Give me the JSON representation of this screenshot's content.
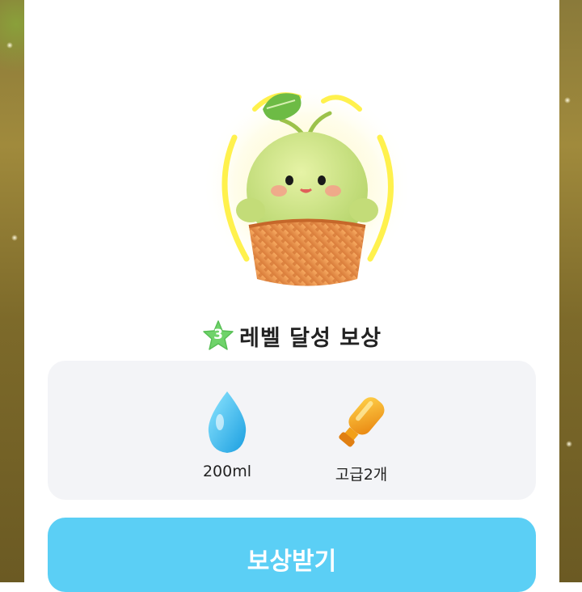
{
  "popup": {
    "title": "레벨 달성 보상",
    "level": "3",
    "claim_label": "보상받기"
  },
  "rewards": [
    {
      "icon": "water-drop-icon",
      "label": "200ml"
    },
    {
      "icon": "fertilizer-bottle-icon",
      "label": "고급2개"
    }
  ],
  "colors": {
    "accent": "#5bcff5",
    "badge": "#6fd36a",
    "reward_bg": "#f3f4f7"
  }
}
